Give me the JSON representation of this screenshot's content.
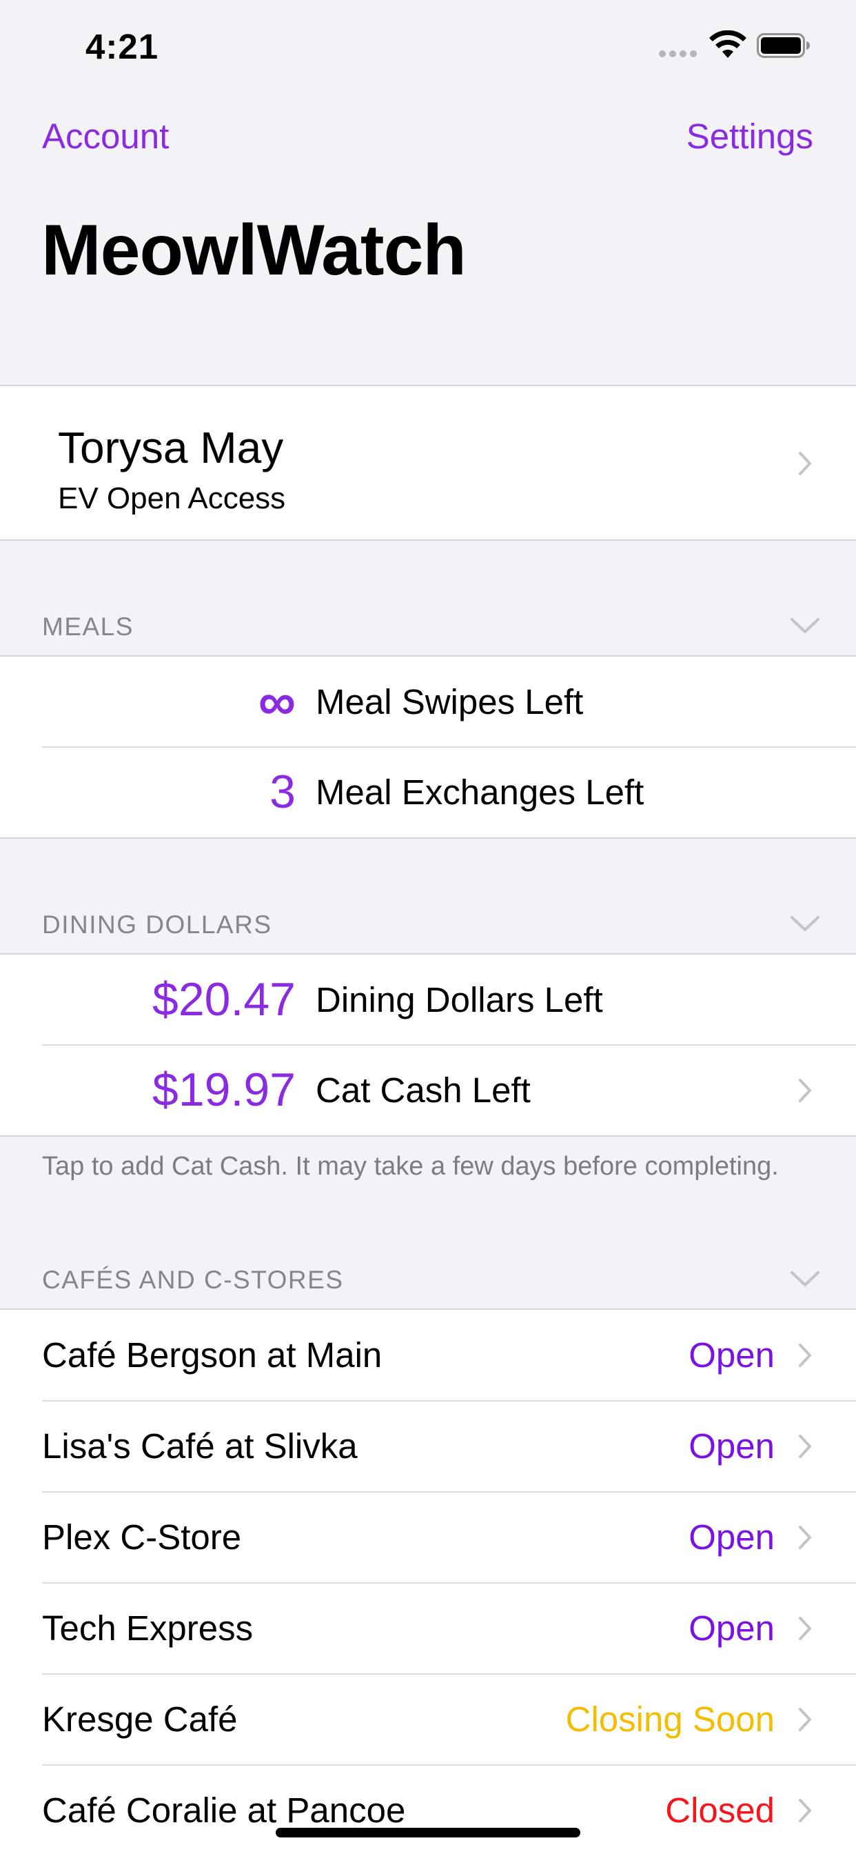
{
  "status_bar": {
    "time": "4:21"
  },
  "nav": {
    "account_label": "Account",
    "settings_label": "Settings",
    "title": "MeowlWatch"
  },
  "account": {
    "name": "Torysa May",
    "plan": "EV Open Access"
  },
  "sections": {
    "meals": {
      "header": "MEALS",
      "rows": [
        {
          "value": "∞",
          "label": "Meal Swipes Left"
        },
        {
          "value": "3",
          "label": "Meal Exchanges Left"
        }
      ]
    },
    "dining_dollars": {
      "header": "DINING DOLLARS",
      "rows": [
        {
          "value": "$20.47",
          "label": "Dining Dollars Left"
        },
        {
          "value": "$19.97",
          "label": "Cat Cash Left"
        }
      ],
      "footer": "Tap to add Cat Cash. It may take a few days before completing."
    },
    "cafes": {
      "header": "CAFÉS AND C-STORES",
      "rows": [
        {
          "name": "Café Bergson at Main",
          "status": "Open"
        },
        {
          "name": "Lisa's Café at Slivka",
          "status": "Open"
        },
        {
          "name": "Plex C-Store",
          "status": "Open"
        },
        {
          "name": "Tech Express",
          "status": "Open"
        },
        {
          "name": "Kresge Café",
          "status": "Closing Soon"
        },
        {
          "name": "Café Coralie at Pancoe",
          "status": "Closed"
        }
      ]
    }
  },
  "colors": {
    "accent": "#8a2be2",
    "open": "#7b13e0",
    "closing_soon": "#f5bd02",
    "closed": "#f4161c",
    "background": "#f2f2f7"
  },
  "icons": {
    "chevron": "chevron-right-icon",
    "section_toggle": "chevron-down-icon",
    "wifi": "wifi-icon",
    "battery": "battery-icon"
  }
}
